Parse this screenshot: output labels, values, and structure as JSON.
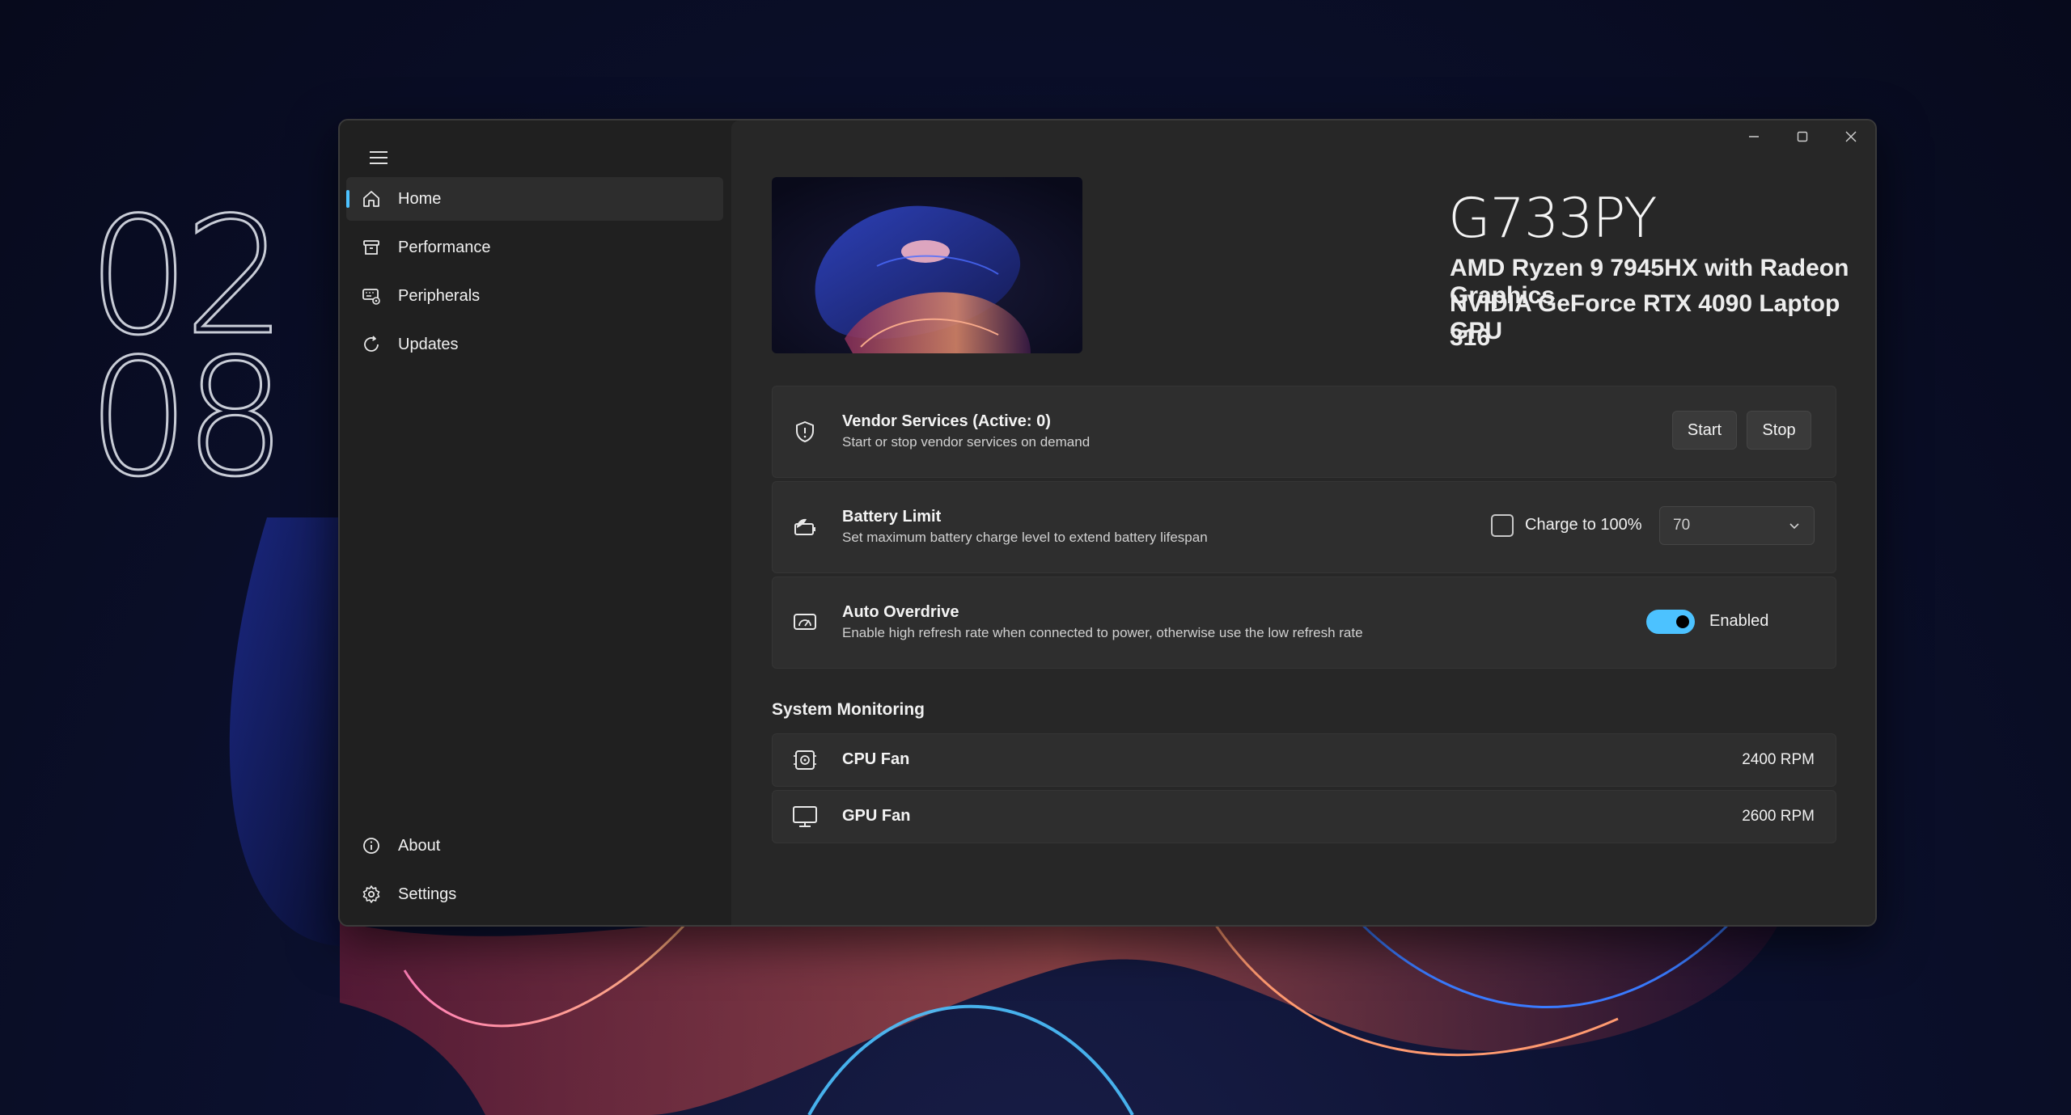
{
  "desktop": {
    "clock_line1": "02",
    "clock_line2": "08"
  },
  "sidebar": {
    "items": [
      {
        "label": "Home",
        "icon": "home-icon",
        "active": true
      },
      {
        "label": "Performance",
        "icon": "archive-icon",
        "active": false
      },
      {
        "label": "Peripherals",
        "icon": "keyboard-gear-icon",
        "active": false
      },
      {
        "label": "Updates",
        "icon": "refresh-icon",
        "active": false
      }
    ],
    "footer_items": [
      {
        "label": "About",
        "icon": "info-icon"
      },
      {
        "label": "Settings",
        "icon": "gear-icon"
      }
    ]
  },
  "device": {
    "model": "G733PY",
    "cpu": "AMD Ryzen 9 7945HX with Radeon Graphics",
    "gpu": "NVIDIA GeForce RTX 4090 Laptop GPU",
    "extra": "316"
  },
  "cards": {
    "vendor": {
      "title": "Vendor Services (Active: 0)",
      "description": "Start or stop vendor services on demand",
      "start_label": "Start",
      "stop_label": "Stop",
      "icon": "shield-icon"
    },
    "battery": {
      "title": "Battery Limit",
      "description": "Set maximum battery charge level to extend battery lifespan",
      "checkbox_label": "Charge to 100%",
      "checkbox_checked": false,
      "limit_value": "70",
      "icon": "battery-leaf-icon"
    },
    "overdrive": {
      "title": "Auto Overdrive",
      "description": "Enable high refresh rate when connected to power, otherwise use the low refresh rate",
      "toggle_label": "Enabled",
      "toggle_on": true,
      "icon": "display-gauge-icon"
    }
  },
  "monitoring": {
    "title": "System Monitoring",
    "rows": [
      {
        "label": "CPU Fan",
        "value": "2400 RPM",
        "icon": "cpu-fan-icon"
      },
      {
        "label": "GPU Fan",
        "value": "2600 RPM",
        "icon": "monitor-icon"
      }
    ]
  },
  "colors": {
    "accent": "#4cc2ff",
    "window_bg": "#202020",
    "card_bg": "#2e2e2e"
  }
}
